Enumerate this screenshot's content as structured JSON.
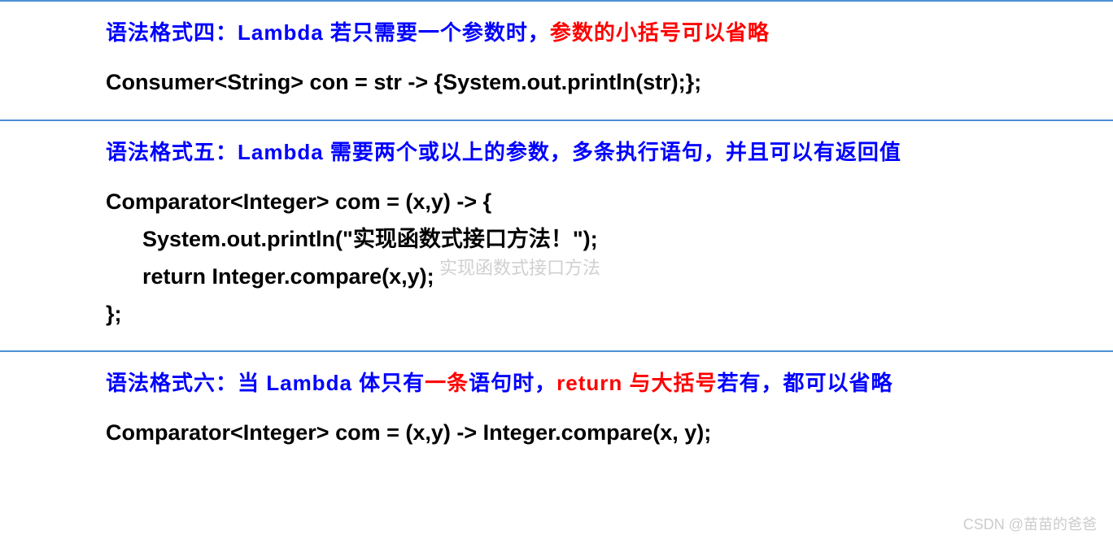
{
  "sections": [
    {
      "title_parts": {
        "prefix": "语法格式四：Lambda 若只需要一个参数时，",
        "highlight": "参数的小括号可以省略"
      },
      "code": "Consumer<String> con = str -> {System.out.println(str);};"
    },
    {
      "title_parts": {
        "prefix": "语法格式五：Lambda 需要两个或以上的参数，多条执行语句，并且可以有返回值",
        "highlight": ""
      },
      "code": "Comparator<Integer> com = (x,y) -> {\n      System.out.println(\"实现函数式接口方法！\");\n      return Integer.compare(x,y);\n};"
    },
    {
      "title_parts": {
        "p1": "语法格式六：当 Lambda 体只有",
        "r1": "一条",
        "p2": "语句时，",
        "r2": "return 与大括号",
        "p3": "若有，都可以省略"
      },
      "code": "Comparator<Integer> com = (x,y) -> Integer.compare(x, y);"
    }
  ],
  "watermark": "CSDN @苗苗的爸爸",
  "faint_text": "实现函数式接口方法"
}
